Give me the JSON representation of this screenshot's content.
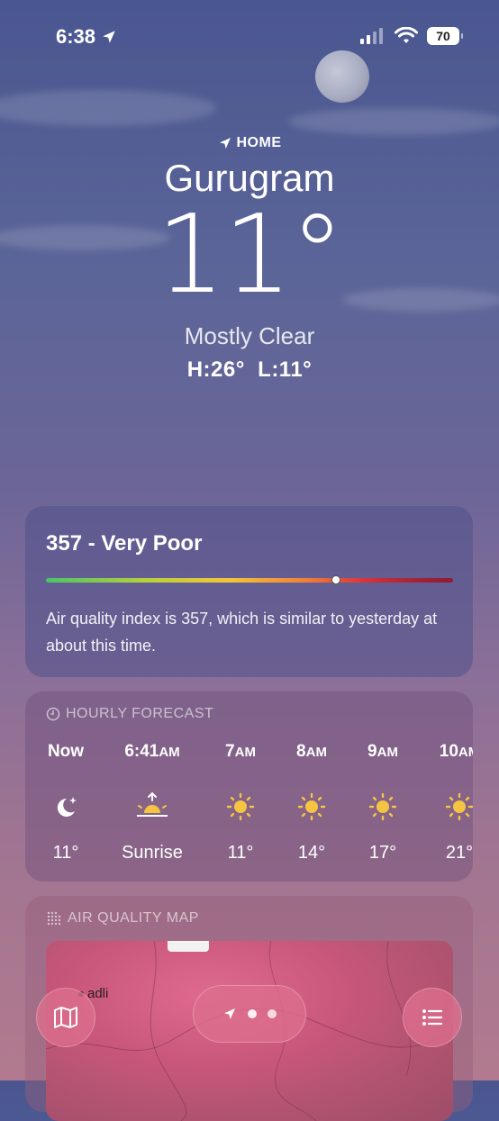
{
  "status_bar": {
    "time": "6:38",
    "battery": "70"
  },
  "header": {
    "location_label": "HOME",
    "city": "Gurugram",
    "temperature": "11°",
    "condition": "Mostly Clear",
    "high_low": "H:26°  L:11°"
  },
  "air_quality": {
    "title": "357 - Very Poor",
    "level_fraction": 0.71,
    "description": "Air quality index is 357, which is similar to yesterday at about this time."
  },
  "hourly_forecast": {
    "label": "HOURLY FORECAST",
    "hours": [
      {
        "time": "Now",
        "suffix": "",
        "icon": "moon-stars-icon",
        "temp": "11°"
      },
      {
        "time": "6:41",
        "suffix": "AM",
        "icon": "sunrise-icon",
        "temp": "Sunrise"
      },
      {
        "time": "7",
        "suffix": "AM",
        "icon": "sun-icon",
        "temp": "11°"
      },
      {
        "time": "8",
        "suffix": "AM",
        "icon": "sun-icon",
        "temp": "14°"
      },
      {
        "time": "9",
        "suffix": "AM",
        "icon": "sun-icon",
        "temp": "17°"
      },
      {
        "time": "10",
        "suffix": "AM",
        "icon": "sun-icon",
        "temp": "21°"
      }
    ]
  },
  "air_quality_map": {
    "label": "AIR QUALITY MAP",
    "place": "adli"
  },
  "colors": {
    "sun": "#f5c542",
    "aq_start": "#4cc36a",
    "aq_end": "#8c1d36"
  }
}
